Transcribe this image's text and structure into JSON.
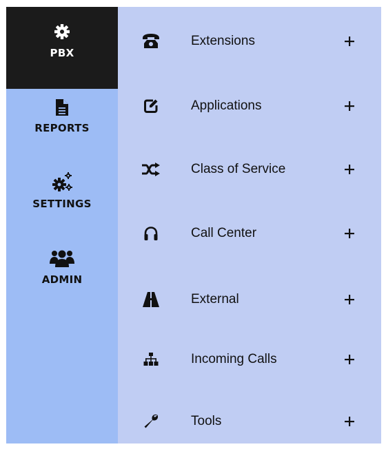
{
  "rail": {
    "items": [
      {
        "label": "PBX",
        "icon": "gear-icon",
        "active": true
      },
      {
        "label": "REPORTS",
        "icon": "document-icon",
        "active": false
      },
      {
        "label": "SETTINGS",
        "icon": "gears-icon",
        "active": false
      },
      {
        "label": "ADMIN",
        "icon": "users-icon",
        "active": false
      }
    ]
  },
  "menu": {
    "items": [
      {
        "label": "Extensions",
        "icon": "phone-icon",
        "action": "+"
      },
      {
        "label": "Applications",
        "icon": "edit-icon",
        "action": "+"
      },
      {
        "label": "Class of Service",
        "icon": "shuffle-icon",
        "action": "+"
      },
      {
        "label": "Call Center",
        "icon": "headphones-icon",
        "action": "+"
      },
      {
        "label": "External",
        "icon": "road-icon",
        "action": "+"
      },
      {
        "label": "Incoming Calls",
        "icon": "sitemap-icon",
        "action": "+"
      },
      {
        "label": "Tools",
        "icon": "wrench-icon",
        "action": "+"
      }
    ]
  },
  "colors": {
    "rail_bg": "#9dbcf5",
    "rail_active_bg": "#1b1b1b",
    "menu_bg": "#c0cdf3",
    "text": "#111111"
  }
}
